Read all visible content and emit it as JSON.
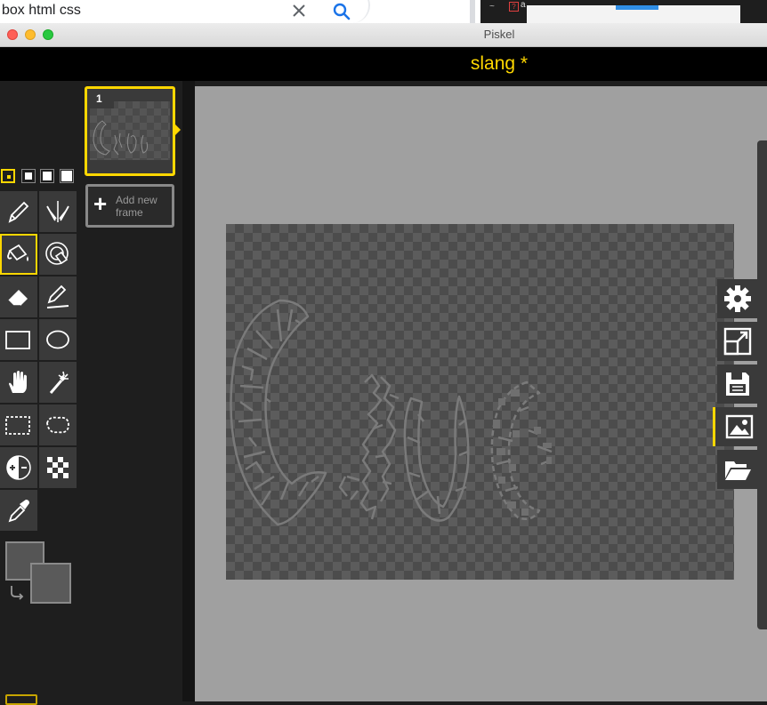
{
  "browser": {
    "search_value": "box html css",
    "clear_icon": "close-icon",
    "search_icon": "search-icon"
  },
  "window": {
    "title": "Piskel"
  },
  "app": {
    "piskel_name": "slang *",
    "accent_color": "#ffd700"
  },
  "tools": {
    "pen_sizes": [
      "1",
      "2",
      "3",
      "4"
    ],
    "selected_pen_size": "1",
    "selected_tool": "paint-bucket",
    "items": [
      {
        "name": "pen-tool",
        "icon": "pen-icon"
      },
      {
        "name": "vertical-mirror-pen-tool",
        "icon": "mirror-pen-icon"
      },
      {
        "name": "paint-bucket-tool",
        "icon": "paint-bucket-icon"
      },
      {
        "name": "paint-all-same-color-tool",
        "icon": "color-swap-icon"
      },
      {
        "name": "eraser-tool",
        "icon": "eraser-icon"
      },
      {
        "name": "stroke-tool",
        "icon": "stroke-icon"
      },
      {
        "name": "rectangle-tool",
        "icon": "rectangle-icon"
      },
      {
        "name": "circle-tool",
        "icon": "circle-icon"
      },
      {
        "name": "move-tool",
        "icon": "hand-icon"
      },
      {
        "name": "magic-wand-tool",
        "icon": "magic-wand-icon"
      },
      {
        "name": "rectangle-selection-tool",
        "icon": "rect-select-icon"
      },
      {
        "name": "lasso-selection-tool",
        "icon": "lasso-icon"
      },
      {
        "name": "lighten-tool",
        "icon": "lighten-icon"
      },
      {
        "name": "dithering-tool",
        "icon": "checker-icon"
      },
      {
        "name": "color-picker-tool",
        "icon": "eyedropper-icon"
      }
    ],
    "primary_color": "#555555",
    "secondary_color": "#5a5a5a"
  },
  "frames": {
    "items": [
      {
        "number": "1"
      }
    ],
    "add_label": "Add new frame"
  },
  "settings": {
    "items": [
      {
        "name": "settings",
        "icon": "gear-icon"
      },
      {
        "name": "resize",
        "icon": "resize-icon"
      },
      {
        "name": "save",
        "icon": "floppy-icon"
      },
      {
        "name": "export",
        "icon": "image-icon",
        "active": true
      },
      {
        "name": "import",
        "icon": "folder-open-icon"
      }
    ]
  }
}
